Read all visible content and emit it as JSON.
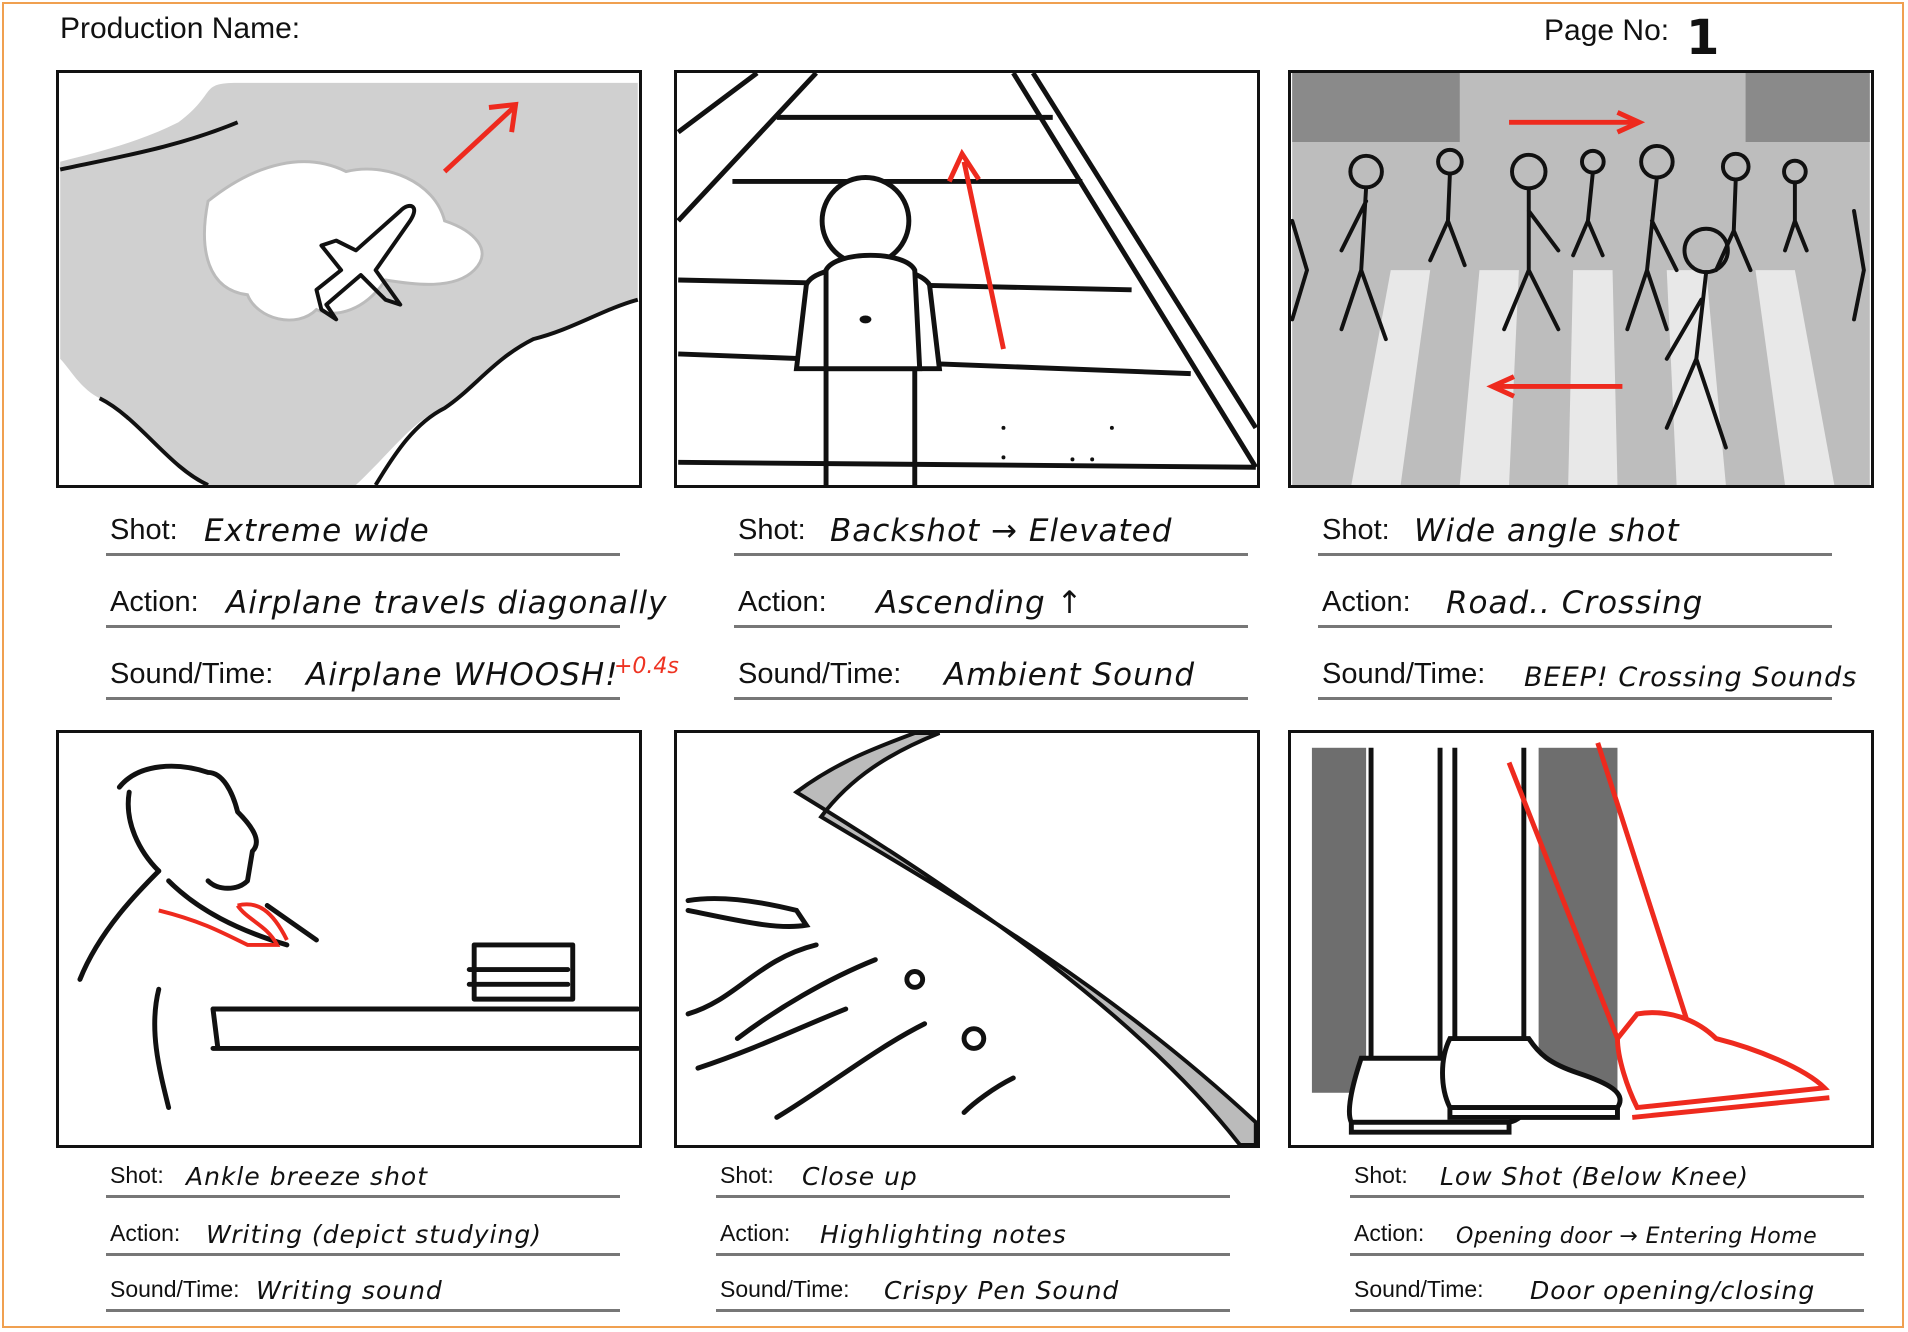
{
  "header": {
    "production_label": "Production Name:",
    "page_label": "Page No:",
    "page_number": "1"
  },
  "labels": {
    "shot": "Shot:",
    "action": "Action:",
    "sound": "Sound/Time:"
  },
  "panels": [
    {
      "shot": "Extreme wide",
      "action": "Airplane travels diagonally",
      "sound": "Airplane WHOOSH!",
      "note": "+0.4s",
      "sketch_icon": "airplane-clouds-icon"
    },
    {
      "shot": "Backshot → Elevated",
      "action": "Ascending ↑",
      "sound": "Ambient Sound",
      "sketch_icon": "person-stairs-icon"
    },
    {
      "shot": "Wide angle shot",
      "action": "Road.. Crossing",
      "sound": "BEEP! Crossing Sounds",
      "sketch_icon": "crowd-crosswalk-icon"
    },
    {
      "shot": "Ankle breeze shot",
      "action": "Writing (depict studying)",
      "sound": "Writing sound",
      "sketch_icon": "boy-writing-desk-icon"
    },
    {
      "shot": "Close up",
      "action": "Highlighting notes",
      "sound": "Crispy Pen Sound",
      "sketch_icon": "pen-notes-icon"
    },
    {
      "shot": "Low Shot (Below Knee)",
      "action": "Opening door → Entering Home",
      "sound": "Door opening/closing",
      "sketch_icon": "feet-doorway-icon"
    }
  ],
  "colors": {
    "accent_red": "#ee2a1e",
    "fill_gray": "#d0d0d0",
    "dark_gray": "#6e6e6e",
    "page_border": "#f0a050"
  }
}
